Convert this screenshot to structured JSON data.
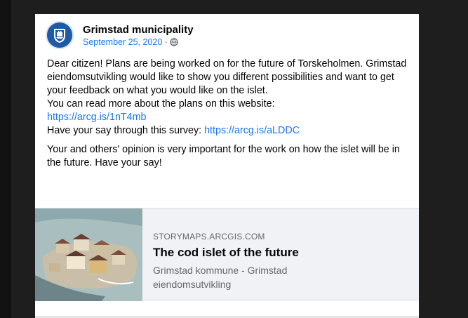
{
  "post": {
    "author": "Grimstad municipality",
    "date": "September 25, 2020",
    "separator": "·",
    "privacy_icon": "globe-icon",
    "text": {
      "line1": "Dear citizen! Plans are being worked on for the future of Torskeholmen. Grimstad eiendomsutvikling would like to show you different possibilities and want to get your feedback on what you would like on the islet.",
      "line2": "You can read more about the plans on this website:",
      "link1": "https://arcg.is/1nT4mb",
      "line3": "Have your say through this survey:",
      "link2": "https://arcg.is/aLDDC",
      "line4": "Your and others' opinion is very important for the work on how the islet will be in the future. Have your say!"
    }
  },
  "link_preview": {
    "domain": "STORYMAPS.ARCGIS.COM",
    "title": "The cod islet of the future",
    "description": "Grimstad kommune - Grimstad eiendomsutvikling"
  },
  "colors": {
    "link": "#1877f2",
    "avatar": "#1f5aa6",
    "background": "#1e1e1e"
  }
}
